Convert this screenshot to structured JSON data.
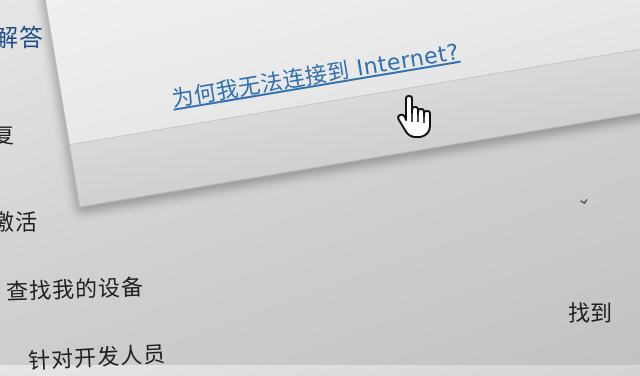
{
  "sidebar": {
    "items": [
      {
        "label": "解答"
      },
      {
        "label": "复"
      },
      {
        "label": "激活"
      },
      {
        "label": "查找我的设备"
      },
      {
        "label": "针对开发人员"
      }
    ]
  },
  "main": {
    "right_partial_text": "找到",
    "right_partial_glyph": "⌄"
  },
  "dialog": {
    "help_link": "为何我无法连接到 Internet?"
  },
  "icons": {
    "cursor": "hand-pointer-icon"
  },
  "colors": {
    "link": "#2f6fae",
    "text": "#202020"
  }
}
